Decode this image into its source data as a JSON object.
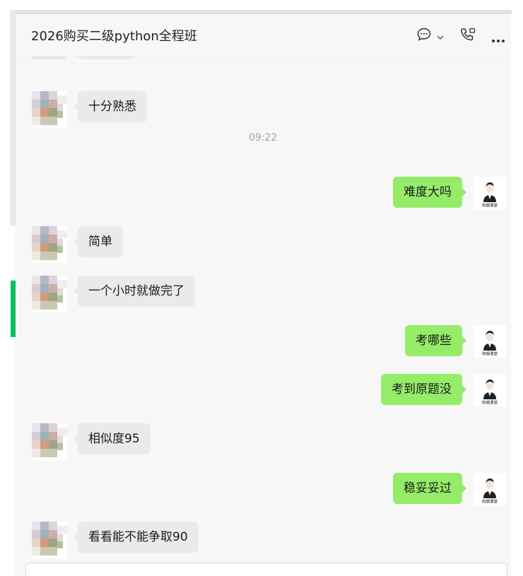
{
  "header": {
    "title": "2026购买二级python全程班",
    "icons": [
      "chat-bubble-icon",
      "chevron-down-icon",
      "phone-icon",
      "more-icon"
    ]
  },
  "colors": {
    "accent": "#07c160",
    "bubble_self": "#95ec69",
    "bubble_other": "#eaeaea"
  },
  "messages": [
    {
      "side": "left",
      "text": "十分熟悉"
    },
    {
      "type": "time",
      "text": "09:22"
    },
    {
      "side": "right",
      "text": "难度大吗"
    },
    {
      "side": "left",
      "text": "简单"
    },
    {
      "side": "left",
      "text": "一个小时就做完了"
    },
    {
      "side": "right",
      "text": "考哪些"
    },
    {
      "side": "right",
      "text": "考到原题没"
    },
    {
      "side": "left",
      "text": "相似度95"
    },
    {
      "side": "right",
      "text": "稳妥妥过"
    },
    {
      "side": "left",
      "text": "看看能不能争取90"
    }
  ],
  "self_avatar_caption": "阿珊课堂"
}
